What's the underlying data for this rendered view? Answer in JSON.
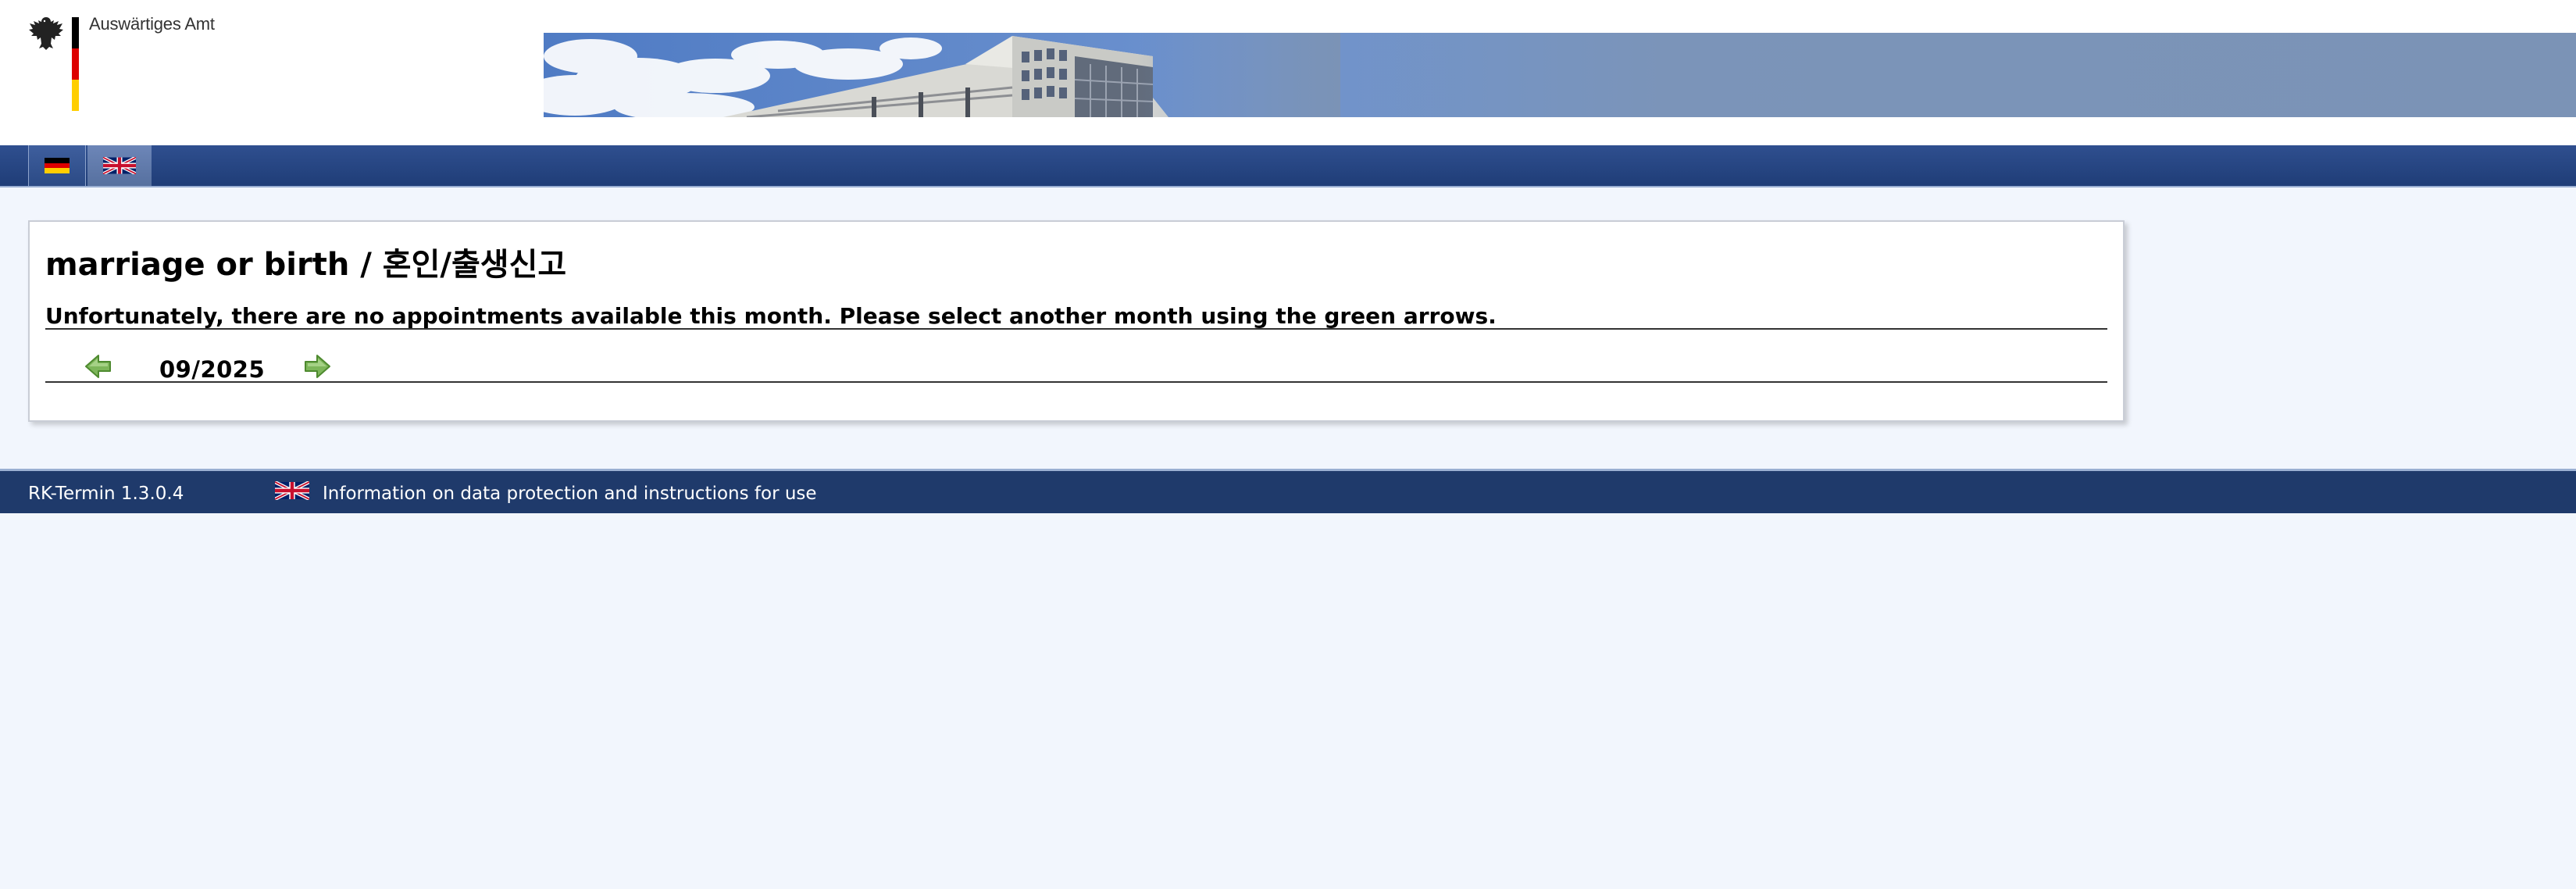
{
  "header": {
    "logo_text": "Auswärtiges Amt",
    "logo_icon": "federal-eagle-icon",
    "banner_image": "building-banner"
  },
  "nav": {
    "languages": [
      {
        "code": "de",
        "icon": "german-flag-icon"
      },
      {
        "code": "en",
        "icon": "uk-flag-icon"
      }
    ]
  },
  "main": {
    "title": "marriage or birth / 혼인/출생신고",
    "message": "Unfortunately, there are no appointments available this month. Please select another month using the green arrows.",
    "month": "09/2025",
    "prev_icon": "green-arrow-left-icon",
    "next_icon": "green-arrow-right-icon"
  },
  "footer": {
    "version": "RK-Termin 1.3.0.4",
    "privacy_link": "Information on data protection and instructions for use",
    "privacy_icon": "uk-flag-icon"
  },
  "colors": {
    "nav_blue": "#1f3d77",
    "footer_blue": "#1f3a6b",
    "page_background": "#f2f6fd",
    "arrow_green": "#6aa84f"
  }
}
